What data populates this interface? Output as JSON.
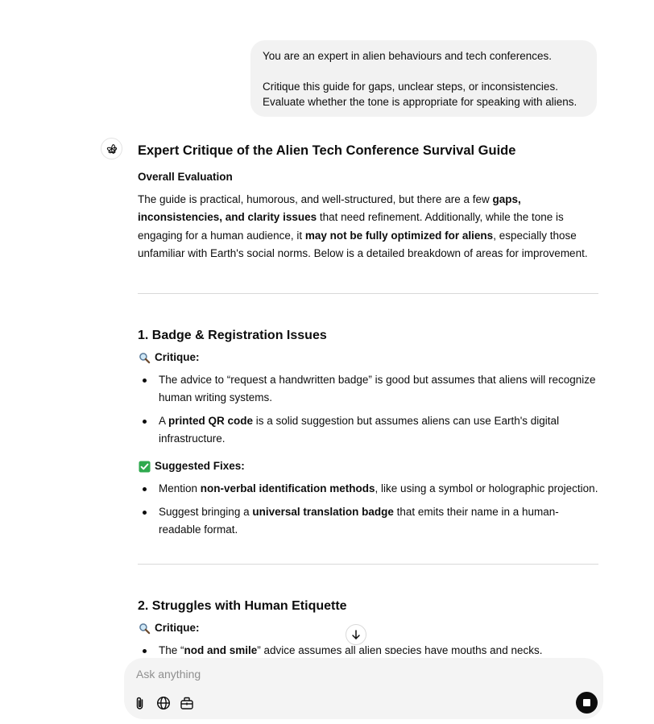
{
  "user_message": {
    "line1": "You are an expert in alien behaviours and tech conferences.",
    "line2": "Critique this guide for gaps, unclear steps, or inconsistencies. Evaluate whether the tone is appropriate for speaking with aliens."
  },
  "answer": {
    "title": "Expert Critique of the Alien Tech Conference Survival Guide",
    "overall_heading": "Overall Evaluation",
    "overall": {
      "t1": "The guide is practical, humorous, and well-structured, but there are a few ",
      "b1": "gaps, inconsistencies, and clarity issues",
      "t2": " that need refinement. Additionally, while the tone is engaging for a human audience, it ",
      "b2": "may not be fully optimized for aliens",
      "t3": ", especially those unfamiliar with Earth's social norms. Below is a detailed breakdown of areas for improvement."
    },
    "section1": {
      "heading": "1. Badge & Registration Issues",
      "critique_label": "Critique:",
      "critique_items": [
        {
          "text": "The advice to “request a handwritten badge” is good but assumes that aliens will recognize human writing systems."
        },
        {
          "pre": "A ",
          "bold": "printed QR code",
          "post": " is a solid suggestion but assumes aliens can use Earth's digital infrastructure."
        }
      ],
      "fixes_label": "Suggested Fixes:",
      "fixes_items": [
        {
          "pre": "Mention ",
          "bold": "non-verbal identification methods",
          "post": ", like using a symbol or holographic projection."
        },
        {
          "pre": "Suggest bringing a ",
          "bold": "universal translation badge",
          "post": " that emits their name in a human-readable format."
        }
      ]
    },
    "section2": {
      "heading": "2. Struggles with Human Etiquette",
      "critique_label": "Critique:",
      "critique_items": [
        {
          "pre": "The “",
          "bold": "nod and smile",
          "post": "” advice assumes all alien species have mouths and necks."
        }
      ]
    }
  },
  "composer": {
    "placeholder": "Ask anything"
  },
  "icons": {
    "assistant": "openai-logo-icon",
    "critique": "magnifier-icon",
    "fixes": "check-mark-button-icon",
    "scroll": "arrow-down-icon",
    "attach": "paperclip-icon",
    "web": "globe-icon",
    "tools": "toolbox-icon",
    "stop": "stop-icon"
  },
  "colors": {
    "bubble": "#f2f2f2",
    "composer": "#f4f4f4",
    "check_green": "#2fa94e"
  }
}
